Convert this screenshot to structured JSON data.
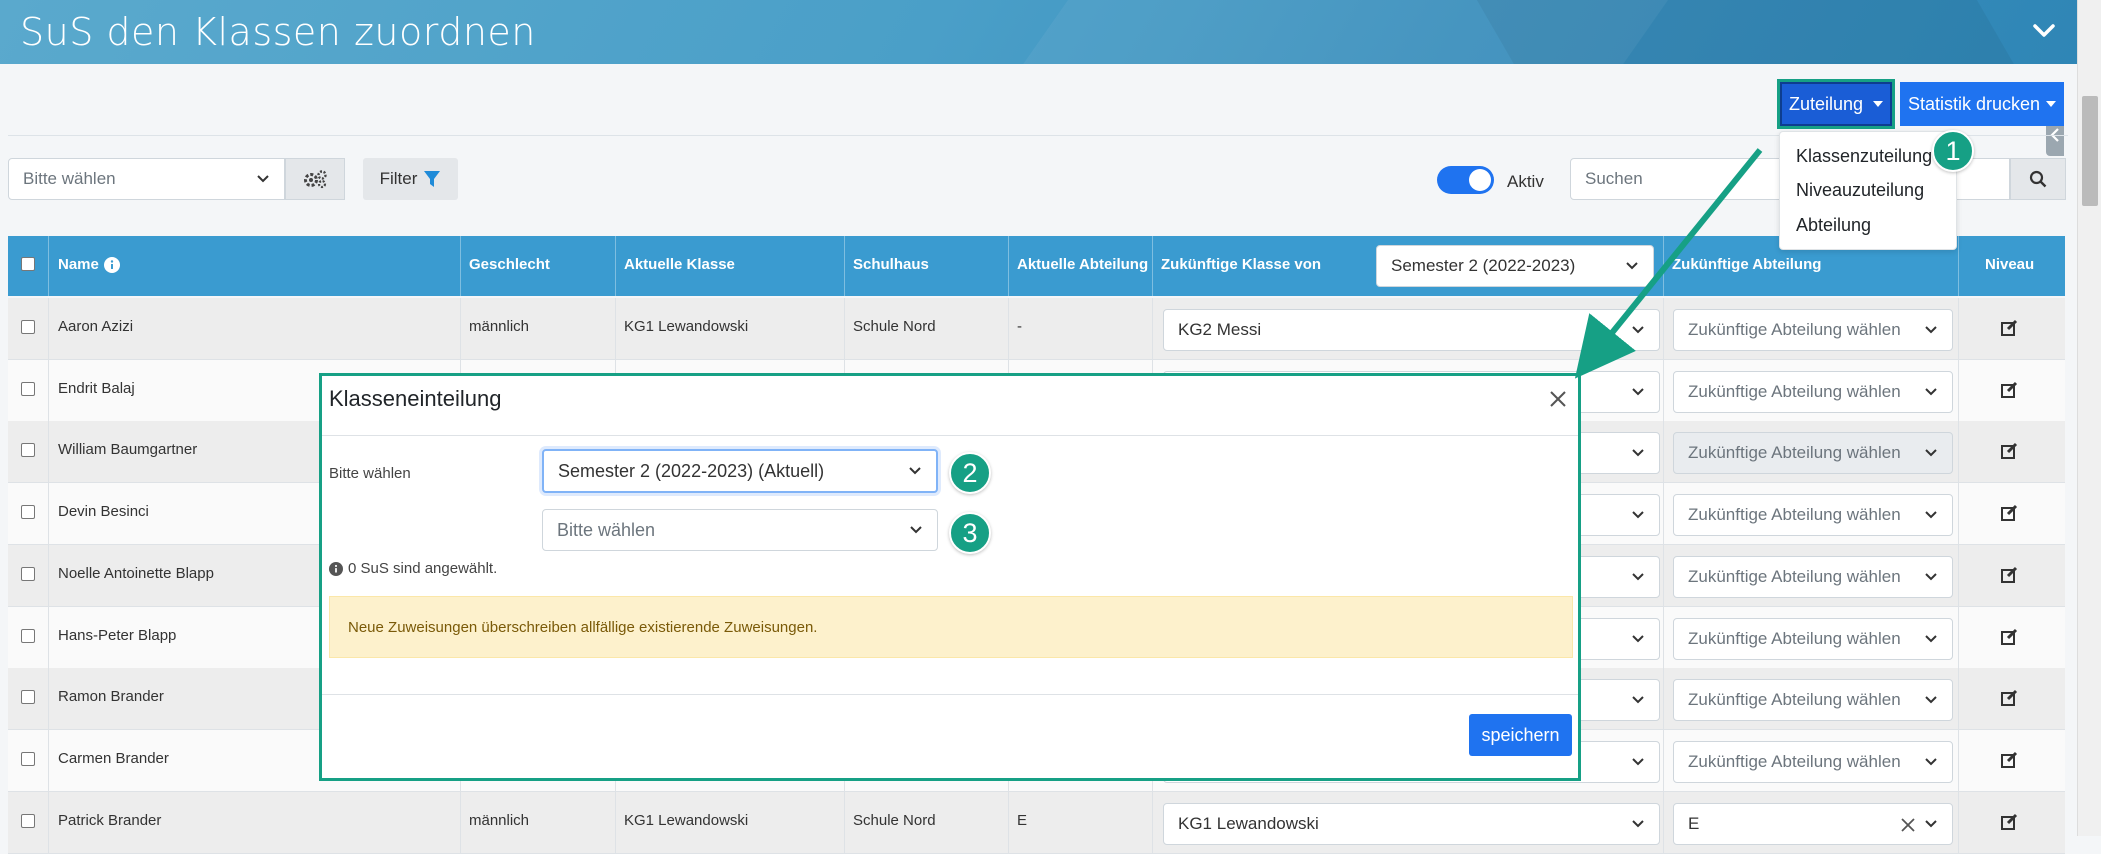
{
  "header": {
    "title": "SuS den Klassen zuordnen"
  },
  "toolbar": {
    "zuteilung_label": "Zuteilung",
    "statistik_label": "Statistik drucken",
    "zuteilung_menu": [
      "Klassenzuteilung",
      "Niveauzuteilung",
      "Abteilung"
    ]
  },
  "filters": {
    "select_placeholder": "Bitte wählen",
    "filter_label": "Filter",
    "toggle_label": "Aktiv",
    "toggle_on": true,
    "search_placeholder": "Suchen"
  },
  "table": {
    "headers": {
      "name": "Name",
      "geschlecht": "Geschlecht",
      "aktuelle_klasse": "Aktuelle Klasse",
      "schulhaus": "Schulhaus",
      "aktuelle_abteilung": "Aktuelle Abteilung",
      "zukuenftige_klasse": "Zukünftige Klasse von",
      "zukuenftige_abteilung": "Zukünftige Abteilung",
      "niveau": "Niveau"
    },
    "semester_select": "Semester 2 (2022-2023)",
    "abteilung_placeholder": "Zukünftige Abteilung wählen",
    "rows": [
      {
        "name": "Aaron Azizi",
        "geschlecht": "männlich",
        "klasse": "KG1 Lewandowski",
        "schulhaus": "Schule Nord",
        "abteilung": "-",
        "zukunft_klasse": "KG2 Messi",
        "zukunft_abteilung": ""
      },
      {
        "name": "Endrit Balaj",
        "geschlecht": "",
        "klasse": "",
        "schulhaus": "",
        "abteilung": "",
        "zukunft_klasse": "",
        "zukunft_abteilung": ""
      },
      {
        "name": "William Baumgartner",
        "geschlecht": "",
        "klasse": "",
        "schulhaus": "",
        "abteilung": "",
        "zukunft_klasse": "",
        "zukunft_abteilung": ""
      },
      {
        "name": "Devin Besinci",
        "geschlecht": "",
        "klasse": "",
        "schulhaus": "",
        "abteilung": "",
        "zukunft_klasse": "",
        "zukunft_abteilung": ""
      },
      {
        "name": "Noelle Antoinette Blapp",
        "geschlecht": "",
        "klasse": "",
        "schulhaus": "",
        "abteilung": "",
        "zukunft_klasse": "",
        "zukunft_abteilung": ""
      },
      {
        "name": "Hans-Peter Blapp",
        "geschlecht": "",
        "klasse": "",
        "schulhaus": "",
        "abteilung": "",
        "zukunft_klasse": "",
        "zukunft_abteilung": ""
      },
      {
        "name": "Ramon Brander",
        "geschlecht": "",
        "klasse": "",
        "schulhaus": "",
        "abteilung": "",
        "zukunft_klasse": "",
        "zukunft_abteilung": ""
      },
      {
        "name": "Carmen Brander",
        "geschlecht": "",
        "klasse": "",
        "schulhaus": "",
        "abteilung": "",
        "zukunft_klasse": "",
        "zukunft_abteilung": ""
      },
      {
        "name": "Patrick Brander",
        "geschlecht": "männlich",
        "klasse": "KG1 Lewandowski",
        "schulhaus": "Schule Nord",
        "abteilung": "E",
        "zukunft_klasse": "KG1 Lewandowski",
        "zukunft_abteilung": "E"
      }
    ]
  },
  "modal": {
    "title": "Klasseneinteilung",
    "label": "Bitte wählen",
    "semester_value": "Semester 2 (2022-2023) (Aktuell)",
    "second_placeholder": "Bitte wählen",
    "info_text": "0 SuS sind angewählt.",
    "alert_text": "Neue Zuweisungen überschreiben allfällige existierende Zuweisungen.",
    "save_label": "speichern"
  },
  "annotations": {
    "badge1": "1",
    "badge2": "2",
    "badge3": "3"
  },
  "colors": {
    "accent": "#16a085",
    "primary": "#1f73f0",
    "table_header": "#3a9bd0",
    "alert_bg": "#fdf1cc"
  }
}
